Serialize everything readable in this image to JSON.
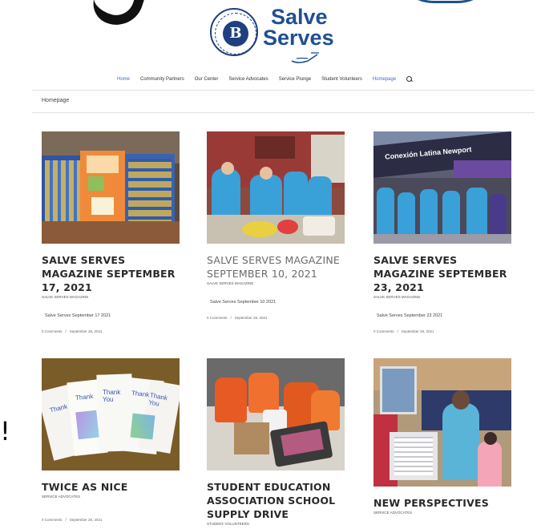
{
  "site": {
    "logo_line1": "Salve",
    "logo_line2": "Serves",
    "seal_letter": "B"
  },
  "nav": [
    {
      "label": "Home",
      "active": true
    },
    {
      "label": "Community Partners",
      "active": false
    },
    {
      "label": "Our Center",
      "active": false
    },
    {
      "label": "Service Advocates",
      "active": false
    },
    {
      "label": "Service Plunge",
      "active": false
    },
    {
      "label": "Student Volunteers",
      "active": false
    },
    {
      "label": "Homepage",
      "active": true
    }
  ],
  "breadcrumb": "Homepage",
  "posts": [
    {
      "title": "SALVE SERVES MAGAZINE SEPTEMBER 17, 2021",
      "category": "SALVE SERVES MAGAZINE",
      "excerpt": "Salve Serves September 17 2021",
      "comments": "0 Comments",
      "date": "September 28, 2021",
      "image": "classroom-poster-display"
    },
    {
      "title": "SALVE SERVES MAGAZINE SEPTEMBER 10, 2021",
      "category": "SALVE SERVES MAGAZINE",
      "excerpt": "Salve Serves September 10 2021",
      "comments": "0 Comments",
      "date": "September 28, 2021",
      "image": "volunteers-kitchen"
    },
    {
      "title": "SALVE SERVES MAGAZINE SEPTEMBER 23, 2021",
      "category": "SALVE SERVES MAGAZINE",
      "excerpt": "Salve Serves September 23 2021",
      "comments": "0 Comments",
      "date": "September 28, 2021",
      "image": "volunteers-storefront",
      "storefront_sign": "Conexión Latina Newport"
    },
    {
      "title": "TWICE AS NICE",
      "category": "SERVICE ADVOCATES",
      "comments": "0 Comments",
      "date": "September 28, 2021",
      "image": "thank-you-cards",
      "card_text": [
        "Thank",
        "Thank",
        "Thank You",
        "Thank",
        "Thank You"
      ]
    },
    {
      "title": "STUDENT EDUCATION ASSOCIATION SCHOOL SUPPLY DRIVE",
      "category": "STUDENT VOLUNTEERS",
      "image": "backpack-donations"
    },
    {
      "title": "NEW PERSPECTIVES",
      "category": "SERVICE ADVOCATES",
      "image": "pantry-volunteers"
    }
  ],
  "colors": {
    "brand_blue": "#1f4f93",
    "nav_active": "#3a6fd8",
    "volunteer_shirt": "#3aa0d8"
  }
}
